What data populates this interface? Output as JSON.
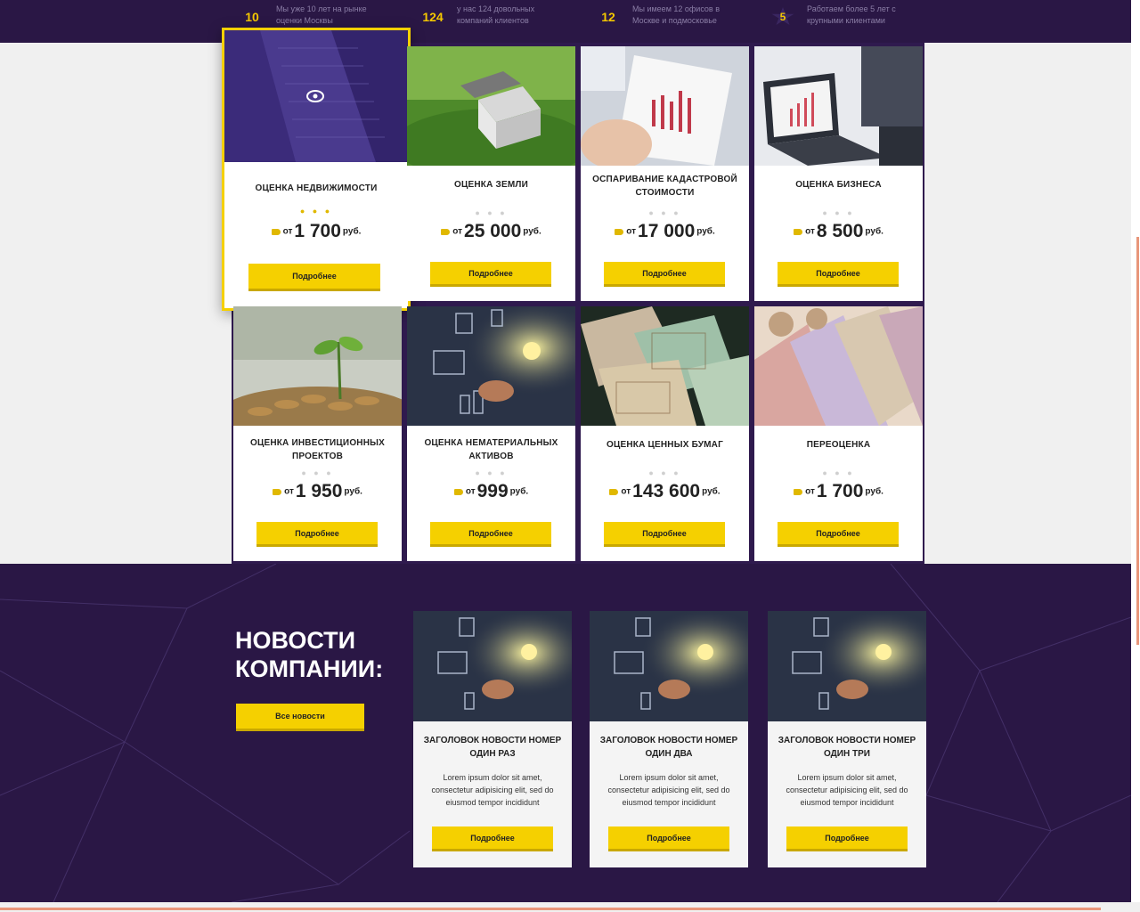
{
  "stats": [
    {
      "num": "10",
      "text": "Мы уже 10 лет на рынке оценки Москвы"
    },
    {
      "num": "124",
      "text": "у нас 124 довольных компаний клиентов"
    },
    {
      "num": "12",
      "text": "Мы имеем 12 офисов в Москве и подмосковье"
    },
    {
      "num": "5",
      "text": "Работаем более 5 лет с крупными клиентами"
    }
  ],
  "services": [
    {
      "title": "Оценка недвижимости",
      "from": "от",
      "price": "1 700",
      "currency": "руб.",
      "button": "Подробнее"
    },
    {
      "title": "Оценка земли",
      "from": "от",
      "price": "25 000",
      "currency": "руб.",
      "button": "Подробнее"
    },
    {
      "title": "Оспаривание кадастровой стоимости",
      "from": "от",
      "price": "17 000",
      "currency": "руб.",
      "button": "Подробнее"
    },
    {
      "title": "Оценка бизнеса",
      "from": "от",
      "price": "8 500",
      "currency": "руб.",
      "button": "Подробнее"
    },
    {
      "title": "Оценка инвестиционных проектов",
      "from": "от",
      "price": "1 950",
      "currency": "руб.",
      "button": "Подробнее"
    },
    {
      "title": "Оценка нематериальных активов",
      "from": "от",
      "price": "999",
      "currency": "руб.",
      "button": "Подробнее"
    },
    {
      "title": "Оценка ценных бумаг",
      "from": "от",
      "price": "143 600",
      "currency": "руб.",
      "button": "Подробнее"
    },
    {
      "title": "Переоценка",
      "from": "от",
      "price": "1 700",
      "currency": "руб.",
      "button": "Подробнее"
    }
  ],
  "news": {
    "heading": "Новости компании:",
    "all_button": "Все новости",
    "items": [
      {
        "title": "Заголовок новости номер один раз",
        "text": "Lorem ipsum dolor sit amet, consectetur adipisicing elit, sed do eiusmod tempor incididunt",
        "button": "Подробнее"
      },
      {
        "title": "Заголовок новости номер один два",
        "text": "Lorem ipsum dolor sit amet, consectetur adipisicing elit, sed do eiusmod tempor incididunt",
        "button": "Подробнее"
      },
      {
        "title": "Заголовок новости номер один три",
        "text": "Lorem ipsum dolor sit amet, consectetur adipisicing elit, sed do eiusmod tempor incididunt",
        "button": "Подробнее"
      }
    ]
  },
  "colors": {
    "brand_dark": "#2a1745",
    "accent": "#f5d000"
  }
}
